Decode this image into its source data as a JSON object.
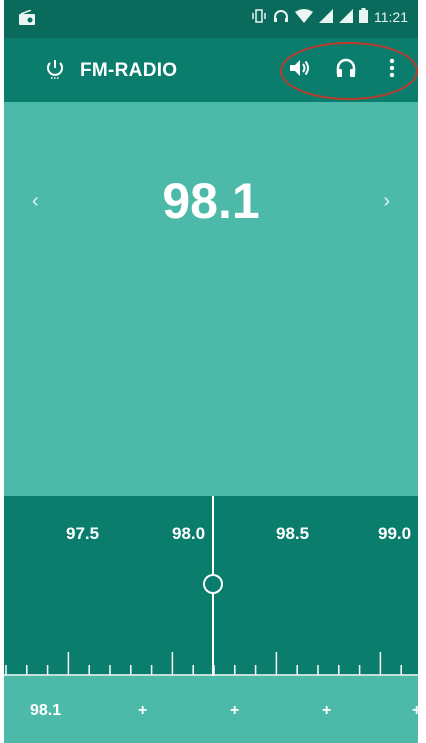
{
  "status_bar": {
    "icons": [
      "radio-icon",
      "vibrate-icon",
      "headset-icon",
      "wifi-icon",
      "signal-icon",
      "signal-icon",
      "battery-icon"
    ],
    "time": "11:21"
  },
  "app_bar": {
    "title": "FM-RADIO",
    "icons": [
      "power-icon",
      "speaker-icon",
      "headphones-icon",
      "more-vert-icon"
    ]
  },
  "main": {
    "frequency": "98.1",
    "prev_label": "‹",
    "next_label": "›"
  },
  "tuner": {
    "scale_labels": [
      "97.5",
      "98.0",
      "98.5",
      "99.0"
    ]
  },
  "presets": {
    "items": [
      "98.1",
      "+",
      "+",
      "+",
      "+"
    ]
  },
  "colors": {
    "status_bar": "#0a6a5b",
    "app_bar": "#0b7d6d",
    "main_bg": "#4dbaa9",
    "tuner_bg": "#0b7d6d",
    "highlight": "#c0392b"
  }
}
